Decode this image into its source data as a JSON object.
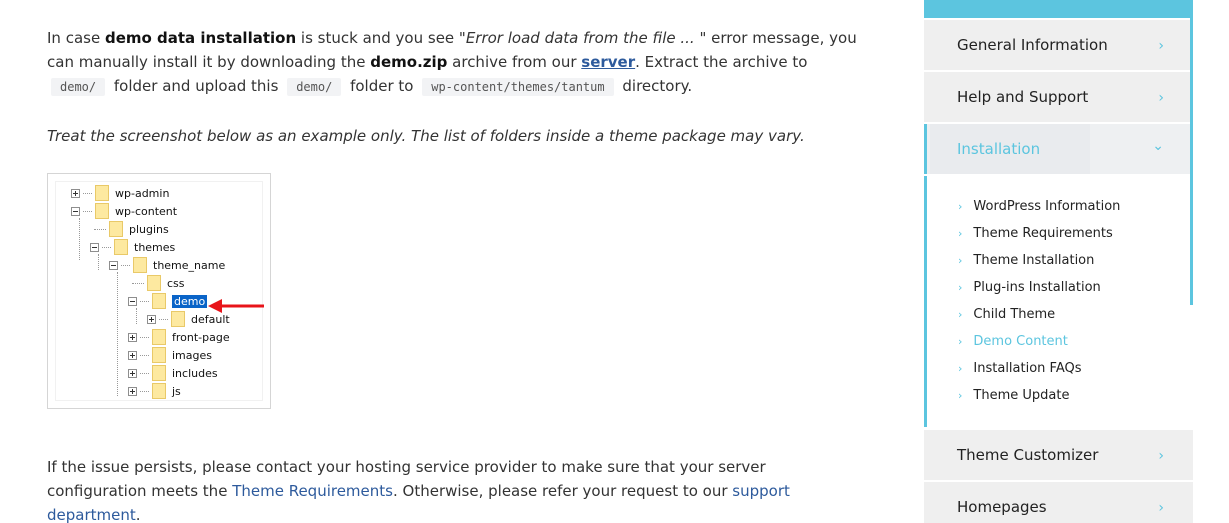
{
  "content": {
    "p1": {
      "t1": "In case ",
      "b1": "demo data installation",
      "t2": " is stuck and you see ",
      "i1": "\"Error load data from the file ... \"",
      "t3": " error message, you can manually install it by downloading the ",
      "b2": "demo.zip",
      "t4": " archive from our ",
      "link_server": "server",
      "t5": ". Extract the archive to ",
      "code1": "demo/",
      "t6": " folder and upload this ",
      "code2": "demo/",
      "t7": " folder to ",
      "code3": "wp-content/themes/tantum",
      "t8": " directory."
    },
    "note": "Treat the screenshot below as an example only. The list of folders inside a theme package may vary.",
    "p2": {
      "t1": "If the issue persists, please contact your hosting service provider to make sure that your server configuration meets the ",
      "link_req": "Theme Requirements",
      "t2": ". Otherwise, please refer your request to our ",
      "link_support": "support department",
      "t3": "."
    }
  },
  "tree": {
    "nodes": [
      "wp-admin",
      "wp-content",
      "plugins",
      "themes",
      "theme_name",
      "css",
      "demo",
      "default",
      "front-page",
      "images",
      "includes",
      "js"
    ],
    "selected": "demo",
    "highlight_color": "#0a64c8",
    "arrow_color": "#e8141a"
  },
  "sidebar": {
    "accent": "#5cc5df",
    "sections": [
      {
        "label": "General Information",
        "icon": "chevron-right-icon"
      },
      {
        "label": "Help and Support",
        "icon": "chevron-right-icon"
      },
      {
        "label": "Installation",
        "icon": "chevron-down-icon",
        "expanded": true
      },
      {
        "label": "Theme Customizer",
        "icon": "chevron-right-icon"
      },
      {
        "label": "Homepages",
        "icon": "chevron-right-icon"
      }
    ],
    "chevron_right": "›",
    "chevron_down": "⌄",
    "sub_items": [
      "WordPress Information",
      "Theme Requirements",
      "Theme Installation",
      "Plug-ins Installation",
      "Child Theme",
      "Demo Content",
      "Installation FAQs",
      "Theme Update"
    ],
    "current_sub": "Demo Content"
  }
}
